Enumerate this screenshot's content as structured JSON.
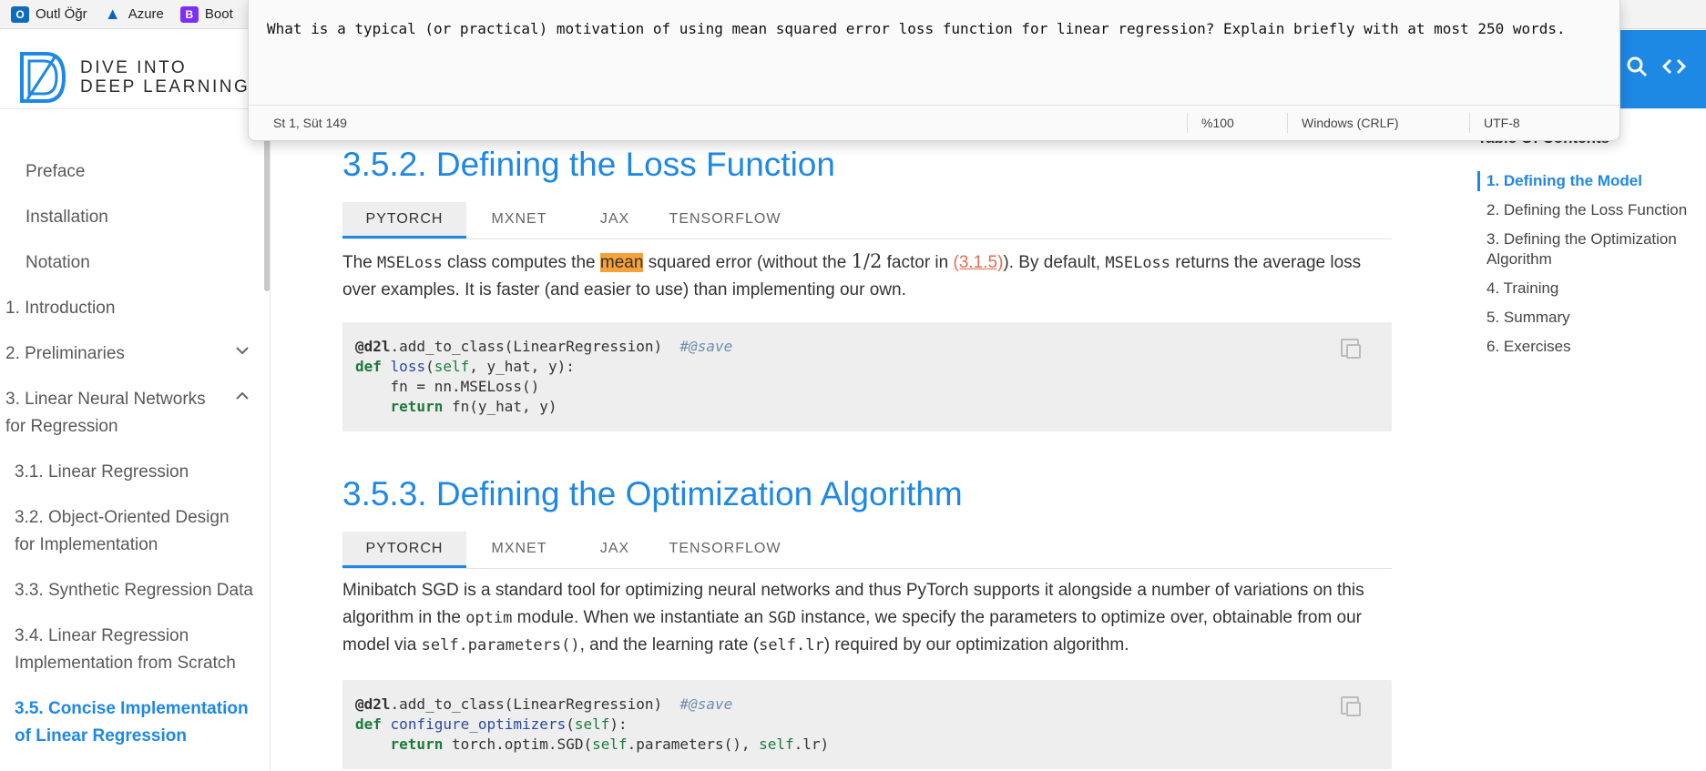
{
  "bookmarks": [
    {
      "label": "Outl Öğr",
      "icon": "outlook-icon"
    },
    {
      "label": "Azure",
      "icon": "azure-icon"
    },
    {
      "label": "Boot",
      "icon": "bootstrap-icon"
    }
  ],
  "logo": {
    "line1": "DIVE INTO",
    "line2": "DEEP LEARNING"
  },
  "editor": {
    "text": "What is a typical (or practical) motivation of using mean squared error loss function for linear regression? Explain briefly with at most 250 words.",
    "status": {
      "position": "St 1, Süt 149",
      "zoom": "%100",
      "line_ending": "Windows (CRLF)",
      "encoding": "UTF-8"
    }
  },
  "sidebar": {
    "items": [
      {
        "label": "Preface"
      },
      {
        "label": "Installation"
      },
      {
        "label": "Notation"
      },
      {
        "label": "1. Introduction"
      },
      {
        "label": "2. Preliminaries"
      },
      {
        "label": "3. Linear Neural Networks for Regression"
      },
      {
        "label": "3.1. Linear Regression"
      },
      {
        "label": "3.2. Object-Oriented Design for Implementation"
      },
      {
        "label": "3.3. Synthetic Regression Data"
      },
      {
        "label": "3.4. Linear Regression Implementation from Scratch"
      },
      {
        "label": "3.5. Concise Implementation of Linear Regression"
      }
    ]
  },
  "main": {
    "section1": {
      "title": "3.5.2. Defining the Loss Function",
      "tabs": [
        "PYTORCH",
        "MXNET",
        "JAX",
        "TENSORFLOW"
      ],
      "p_a": "The ",
      "p_code1": "MSELoss",
      "p_b": " class computes the ",
      "p_hl": "mean",
      "p_c": " squared error (without the ",
      "p_math": "1/2",
      "p_d": " factor in ",
      "p_ref": "(3.1.5)",
      "p_e": "). By default, ",
      "p_code2": "MSELoss",
      "p_f": " returns the average loss over examples. It is faster (and easier to use) than implementing our own."
    },
    "section2": {
      "title": "3.5.3. Defining the Optimization Algorithm",
      "tabs": [
        "PYTORCH",
        "MXNET",
        "JAX",
        "TENSORFLOW"
      ],
      "p_a": "Minibatch SGD is a standard tool for optimizing neural networks and thus PyTorch supports it alongside a number of variations on this algorithm in the ",
      "p_code1": "optim",
      "p_b": " module. When we instantiate an ",
      "p_code2": "SGD",
      "p_c": " instance, we specify the parameters to optimize over, obtainable from our model via ",
      "p_code3": "self.parameters()",
      "p_d": ", and the learning rate (",
      "p_code4": "self.lr",
      "p_e": ") required by our optimization algorithm."
    }
  },
  "toc": {
    "title": "Table Of Contents",
    "items": [
      "1. Defining the Model",
      "2. Defining the Loss Function",
      "3. Defining the Optimization Algorithm",
      "4. Training",
      "5. Summary",
      "6. Exercises"
    ]
  },
  "colors": {
    "accent": "#1e88e5",
    "highlight": "#f7a13b",
    "reference": "#e46a50"
  }
}
